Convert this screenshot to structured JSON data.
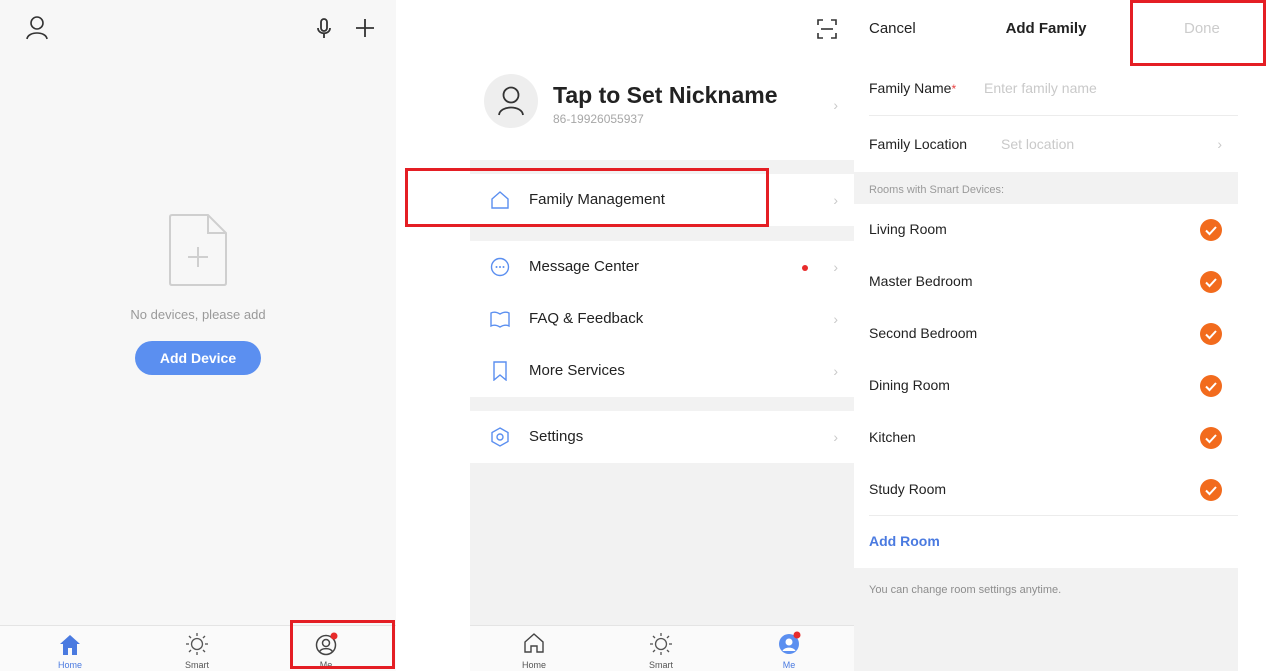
{
  "screen1": {
    "empty_text": "No devices, please add",
    "add_device_label": "Add Device",
    "tabs": [
      {
        "label": "Home",
        "icon": "home-filled-icon",
        "active": true
      },
      {
        "label": "Smart",
        "icon": "sun-icon",
        "active": false
      },
      {
        "label": "Me",
        "icon": "person-circle-icon",
        "active": false,
        "badge": true
      }
    ]
  },
  "screen2": {
    "nickname": "Tap to Set Nickname",
    "phone": "86-19926055937",
    "menu": [
      {
        "label": "Family Management",
        "icon": "house-outline-icon"
      },
      {
        "label": "Message Center",
        "icon": "chat-bubble-icon",
        "badge": true
      },
      {
        "label": "FAQ & Feedback",
        "icon": "book-icon"
      },
      {
        "label": "More Services",
        "icon": "bookmark-icon"
      },
      {
        "label": "Settings",
        "icon": "hex-settings-icon"
      }
    ],
    "tabs": [
      {
        "label": "Home",
        "icon": "home-outline-icon",
        "active": false
      },
      {
        "label": "Smart",
        "icon": "sun-icon",
        "active": false
      },
      {
        "label": "Me",
        "icon": "person-filled-icon",
        "active": true,
        "badge": true
      }
    ]
  },
  "screen3": {
    "cancel_label": "Cancel",
    "title": "Add Family",
    "done_label": "Done",
    "family_name_label": "Family Name",
    "required_mark": "*",
    "family_name_placeholder": "Enter family name",
    "family_location_label": "Family Location",
    "family_location_placeholder": "Set location",
    "rooms_section_title": "Rooms with Smart Devices:",
    "rooms": [
      {
        "name": "Living Room",
        "checked": true
      },
      {
        "name": "Master Bedroom",
        "checked": true
      },
      {
        "name": "Second Bedroom",
        "checked": true
      },
      {
        "name": "Dining Room",
        "checked": true
      },
      {
        "name": "Kitchen",
        "checked": true
      },
      {
        "name": "Study Room",
        "checked": true
      }
    ],
    "add_room_label": "Add Room",
    "footnote": "You can change room settings anytime."
  },
  "colors": {
    "accent_blue": "#5b8ff0",
    "check_orange": "#f26b1d",
    "highlight_red": "#e41e24",
    "badge_red": "#e82b2b"
  }
}
